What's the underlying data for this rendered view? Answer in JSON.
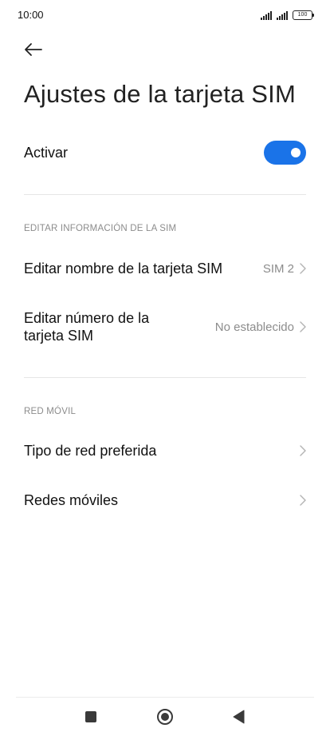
{
  "status_bar": {
    "time": "10:00",
    "battery": "100"
  },
  "header": {
    "title": "Ajustes de la tarjeta SIM"
  },
  "activate": {
    "label": "Activar",
    "enabled": true
  },
  "sections": [
    {
      "title": "EDITAR INFORMACIÓN DE LA SIM",
      "items": [
        {
          "label": "Editar nombre de la tarjeta SIM",
          "value": "SIM 2"
        },
        {
          "label_line1": "Editar número de la",
          "label_line2": "tarjeta SIM",
          "value": "No establecido"
        }
      ]
    },
    {
      "title": "RED MÓVIL",
      "items": [
        {
          "label": "Tipo de red preferida"
        },
        {
          "label": "Redes móviles"
        }
      ]
    }
  ],
  "colors": {
    "accent": "#1a73e8",
    "secondary_text": "#8c8c8c",
    "divider": "#e6e6e6"
  },
  "icons": {
    "back": "arrow-left-icon",
    "chevron": "chevron-right-icon",
    "nav_recent": "square-icon",
    "nav_home": "circle-icon",
    "nav_back": "triangle-left-icon"
  }
}
